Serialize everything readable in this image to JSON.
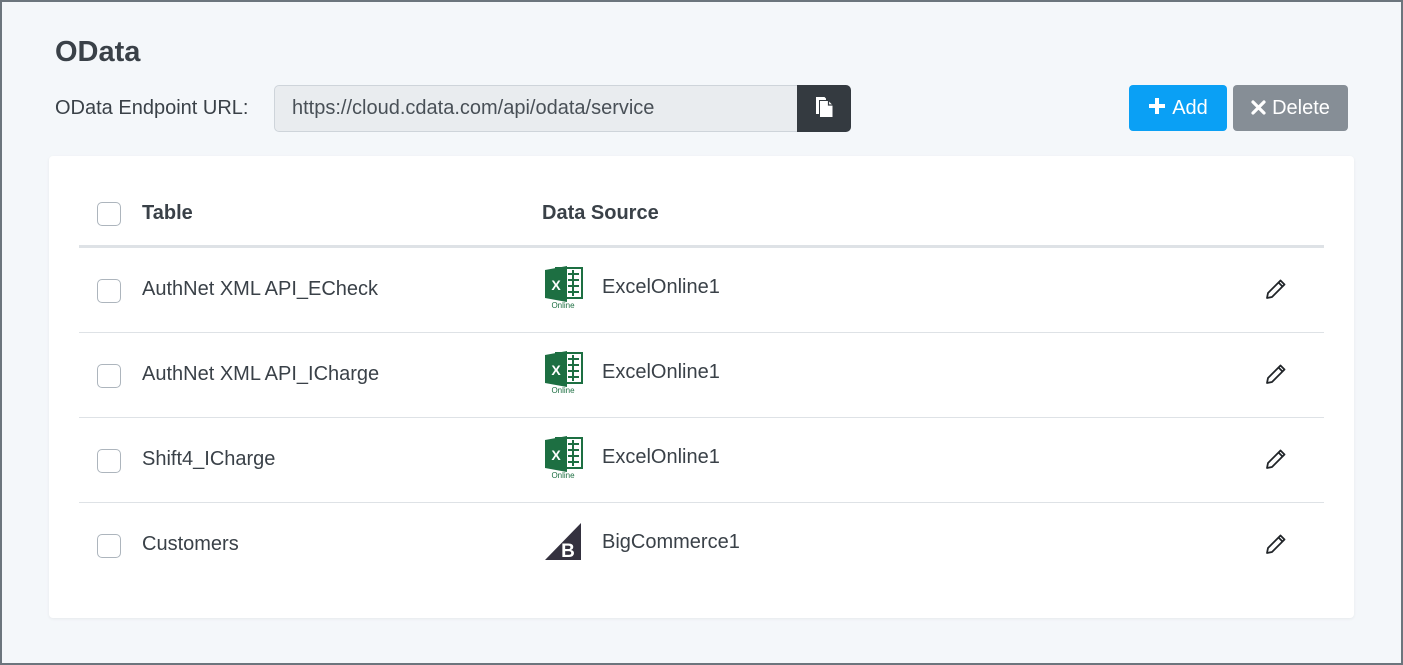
{
  "page": {
    "title": "OData"
  },
  "endpoint": {
    "label": "OData Endpoint URL:",
    "url": "https://cloud.cdata.com/api/odata/service"
  },
  "toolbar": {
    "add_label": "Add",
    "delete_label": "Delete"
  },
  "table": {
    "columns": {
      "table": "Table",
      "data_source": "Data Source"
    },
    "rows": [
      {
        "table": "AuthNet XML API_ECheck",
        "source": "ExcelOnline1",
        "source_icon": "excel-online-icon",
        "source_icon_caption": "Online"
      },
      {
        "table": "AuthNet XML API_ICharge",
        "source": "ExcelOnline1",
        "source_icon": "excel-online-icon",
        "source_icon_caption": "Online"
      },
      {
        "table": "Shift4_ICharge",
        "source": "ExcelOnline1",
        "source_icon": "excel-online-icon",
        "source_icon_caption": "Online"
      },
      {
        "table": "Customers",
        "source": "BigCommerce1",
        "source_icon": "bigcommerce-icon"
      }
    ]
  },
  "icons": {
    "copy": "copy-icon",
    "add": "plus-icon",
    "delete": "times-icon",
    "edit": "pencil-icon"
  },
  "colors": {
    "add_button": "#0aa0f5",
    "delete_button": "#868e96",
    "copy_button": "#343a40",
    "excel_green": "#1d6f42",
    "bigcommerce": "#34313f"
  }
}
